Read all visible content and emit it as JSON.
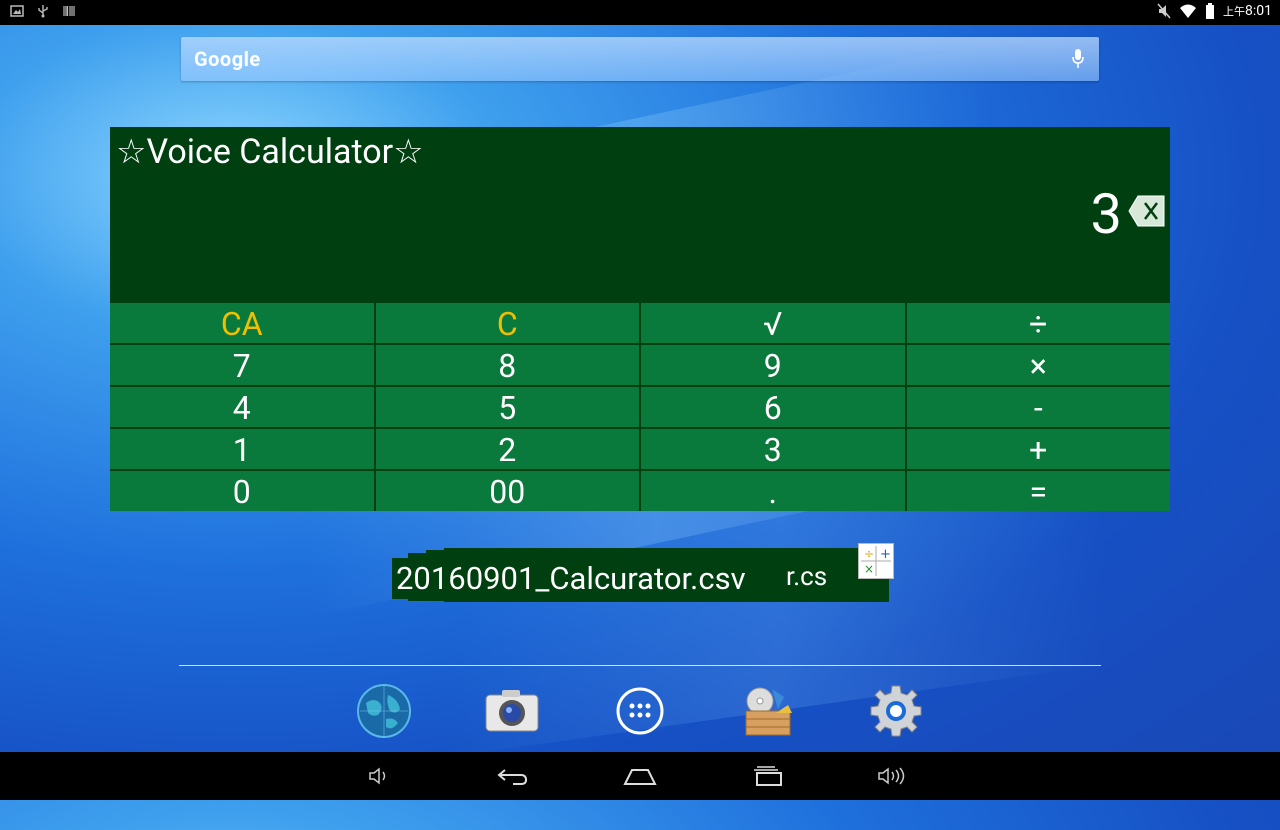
{
  "status_bar": {
    "ampm": "上午",
    "time": "8:01"
  },
  "search": {
    "label": "Google"
  },
  "calculator": {
    "title": "☆Voice Calculator☆",
    "display": "3",
    "keys": [
      {
        "label": "CA",
        "name": "key-clear-all",
        "type": "fn"
      },
      {
        "label": "C",
        "name": "key-clear",
        "type": "fn"
      },
      {
        "label": "√",
        "name": "key-sqrt",
        "type": "op"
      },
      {
        "label": "÷",
        "name": "key-divide",
        "type": "op"
      },
      {
        "label": "7",
        "name": "key-7",
        "type": "num"
      },
      {
        "label": "8",
        "name": "key-8",
        "type": "num"
      },
      {
        "label": "9",
        "name": "key-9",
        "type": "num"
      },
      {
        "label": "×",
        "name": "key-multiply",
        "type": "op"
      },
      {
        "label": "4",
        "name": "key-4",
        "type": "num"
      },
      {
        "label": "5",
        "name": "key-5",
        "type": "num"
      },
      {
        "label": "6",
        "name": "key-6",
        "type": "num"
      },
      {
        "label": "-",
        "name": "key-minus",
        "type": "op"
      },
      {
        "label": "1",
        "name": "key-1",
        "type": "num"
      },
      {
        "label": "2",
        "name": "key-2",
        "type": "num"
      },
      {
        "label": "3",
        "name": "key-3",
        "type": "num"
      },
      {
        "label": "+",
        "name": "key-plus",
        "type": "op"
      },
      {
        "label": "0",
        "name": "key-0",
        "type": "num"
      },
      {
        "label": "00",
        "name": "key-00",
        "type": "num"
      },
      {
        "label": ".",
        "name": "key-decimal",
        "type": "num"
      },
      {
        "label": "=",
        "name": "key-equals",
        "type": "op"
      }
    ]
  },
  "file_shortcut": {
    "label": "20160901_Calcurator.csv",
    "overlap_text": "r.cs"
  },
  "dock": {
    "items": [
      "browser-icon",
      "camera-icon",
      "app-drawer-icon",
      "file-manager-icon",
      "settings-icon"
    ]
  },
  "nav_bar": {
    "buttons": [
      "volume-down-icon",
      "back-icon",
      "home-icon",
      "recents-icon",
      "volume-up-icon"
    ]
  },
  "colors": {
    "widget_bg": "#004010",
    "key_bg": "#0a7a3c",
    "fn_key_text": "#f0c000"
  }
}
